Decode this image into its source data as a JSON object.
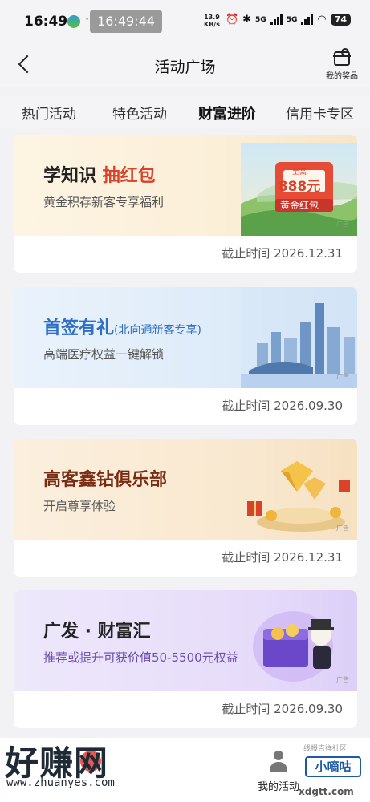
{
  "status_bar": {
    "time": "16:49",
    "clock_overlay": "16:49:44",
    "dots": "··",
    "net_speed_value": "13.9",
    "net_speed_unit": "KB/s",
    "signal_1": "5G",
    "signal_2": "5G",
    "battery": "74"
  },
  "header": {
    "title": "活动广场",
    "prize_label": "我的奖品"
  },
  "tabs": [
    {
      "label": "热门活动",
      "active": false
    },
    {
      "label": "特色活动",
      "active": false
    },
    {
      "label": "财富进阶",
      "active": true
    },
    {
      "label": "信用卡专区",
      "active": false
    }
  ],
  "cards": [
    {
      "title_main": "学知识 ",
      "title_highlight": "抽红包",
      "desc": "黄金积存新客专享福利",
      "badge_top": "至高",
      "badge_amount": "888元",
      "badge_bottom": "黄金红包",
      "ad": "广告",
      "deadline": "截止时间 2026.12.31",
      "theme": "#fdf3e0"
    },
    {
      "title_main": "首签有礼",
      "title_sub": "(北向通新客专享)",
      "desc": "高端医疗权益一键解锁",
      "ad": "广告",
      "deadline": "截止时间 2026.09.30",
      "theme": "#e6f0fb"
    },
    {
      "title_main": "高客鑫钻俱乐部",
      "desc": "开启尊享体验",
      "ad": "广告",
      "deadline": "截止时间 2026.12.31",
      "theme": "#fbeedd"
    },
    {
      "title_main": "广发 · 财富汇",
      "desc": "推荐或提升可获价值50-5500元权益",
      "ad": "广告",
      "deadline": "截止时间 2026.09.30",
      "theme": "#ece6fb"
    }
  ],
  "bottom_nav": {
    "my_activity": "我的活动"
  },
  "watermark": {
    "left_text": "好赚网",
    "left_url": "www.zhuanyes.com",
    "right_top": "线报吉祥社区",
    "right_badge": "小嘀咕",
    "right_url": "xdgtt.com"
  },
  "colors": {
    "accent_red": "#d9422b",
    "accent_blue": "#2d6fc7",
    "background": "#f2f2f4"
  }
}
